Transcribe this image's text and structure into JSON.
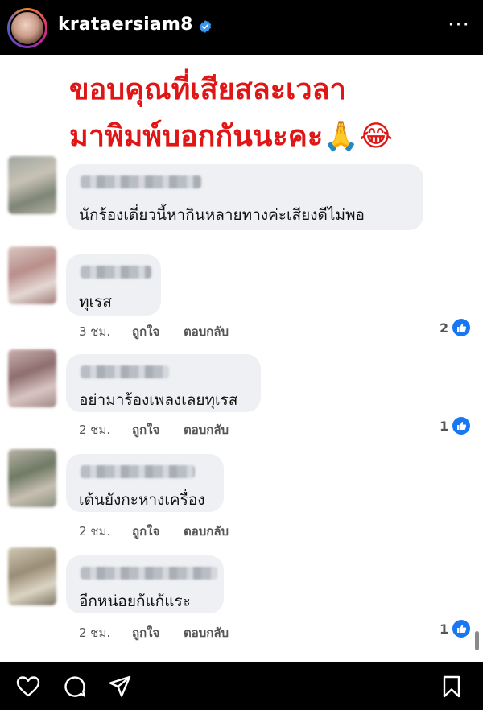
{
  "header": {
    "username": "krataersiam8",
    "more_label": "···",
    "verified_icon": "verified-badge-icon",
    "avatar_icon": "profile-avatar"
  },
  "post": {
    "headline_line1": "ขอบคุณที่เสียสละเวลา",
    "headline_line2": "มาพิมพ์บอกกันนะคะ🙏😂",
    "comments": [
      {
        "text": "นักร้องเดี่ยวนี้หากินหลายทางค่ะเสียงดีไม่พอ",
        "time": "",
        "like": "",
        "reply": "",
        "likes": ""
      },
      {
        "text": "ทุเรส",
        "time": "3 ชม.",
        "like": "ถูกใจ",
        "reply": "ตอบกลับ",
        "likes": "2"
      },
      {
        "text": "อย่ามาร้องเพลงเลยทุเรส",
        "time": "2 ชม.",
        "like": "ถูกใจ",
        "reply": "ตอบกลับ",
        "likes": "1"
      },
      {
        "text": "เต้นยังกะหางเครื่อง",
        "time": "2 ชม.",
        "like": "ถูกใจ",
        "reply": "ตอบกลับ",
        "likes": ""
      },
      {
        "text": "อีกหน่อยก้แก้แระ",
        "time": "2 ชม.",
        "like": "ถูกใจ",
        "reply": "ตอบกลับ",
        "likes": "1"
      }
    ]
  },
  "colors": {
    "headline": "#e01515",
    "like_blue": "#1877f2",
    "bubble": "#eef0f3"
  },
  "bottom_bar": {
    "icons": [
      "heart-icon",
      "comment-icon",
      "share-icon",
      "bookmark-icon"
    ]
  }
}
